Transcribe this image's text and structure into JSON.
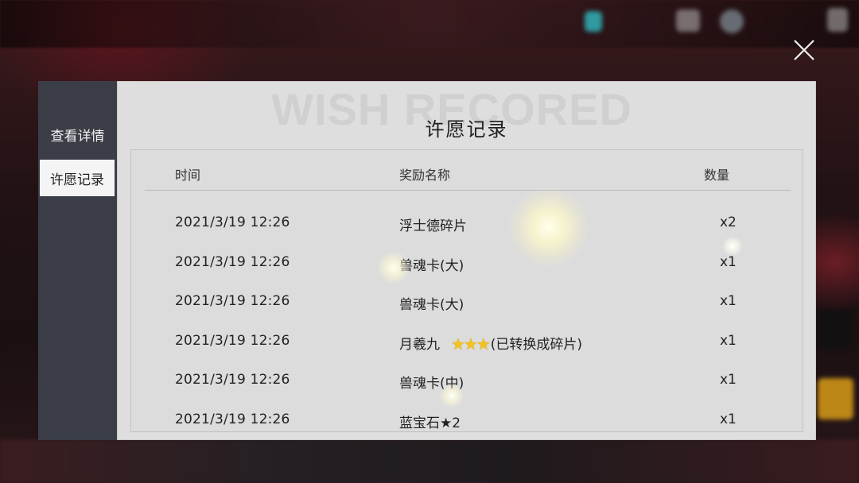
{
  "panel": {
    "watermark": "WISH RECORED",
    "title": "许愿记录"
  },
  "sidebar": {
    "tabs": [
      {
        "label": "查看详情",
        "active": false
      },
      {
        "label": "许愿记录",
        "active": true
      }
    ]
  },
  "table": {
    "headers": {
      "time": "时间",
      "name": "奖励名称",
      "qty": "数量"
    },
    "rows": [
      {
        "time": "2021/3/19 12:26",
        "name": "浮士德碎片",
        "qty": "x2"
      },
      {
        "time": "2021/3/19 12:26",
        "name": "兽魂卡(大)",
        "qty": "x1"
      },
      {
        "time": "2021/3/19 12:26",
        "name": "兽魂卡(大)",
        "qty": "x1"
      },
      {
        "time": "2021/3/19 12:26",
        "name": "月羲九",
        "stars": "★★★",
        "note": "(已转换成碎片)",
        "qty": "x1"
      },
      {
        "time": "2021/3/19 12:26",
        "name": "兽魂卡(中)",
        "qty": "x1"
      },
      {
        "time": "2021/3/19 12:26",
        "name": "蓝宝石★2",
        "qty": "x1"
      }
    ]
  },
  "icons": {
    "close": "close-icon",
    "star": "star-icon"
  },
  "colors": {
    "star": "#f4c21c",
    "panel_bg": "#dedede",
    "sidebar_bg": "#3b3e46"
  }
}
